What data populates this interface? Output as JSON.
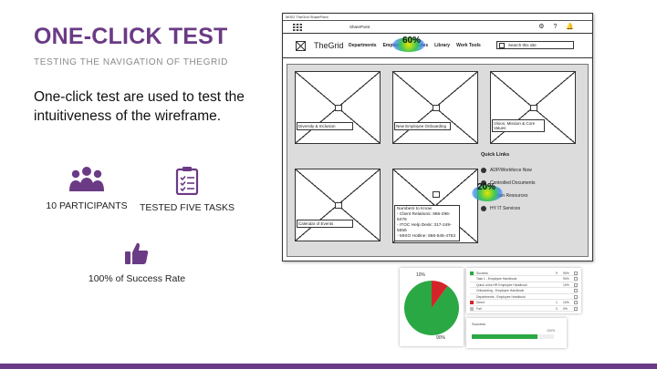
{
  "slide": {
    "title": "ONE-CLICK TEST",
    "subtitle": "TESTING THE NAVIGATION OF THEGRID",
    "intro": "One-click test are used to test the intuitiveness of the wireframe.",
    "accent_color": "#6b3a85"
  },
  "stats": [
    {
      "icon": "people-icon",
      "label": "10 PARTICIPANTS"
    },
    {
      "icon": "clipboard-checklist-icon",
      "label": "TESTED FIVE TASKS"
    },
    {
      "icon": "thumbs-up-icon",
      "label": "100% of Success Rate"
    }
  ],
  "wireframe": {
    "tab_title": "MISO TheGrid SharePoint",
    "app_name": "SharePoint",
    "top_icons": "⚙ ? 🔔",
    "logo": "TheGrid",
    "nav_items": [
      "Departments",
      "Employee",
      "Policies",
      "Library",
      "Work Tools"
    ],
    "search_placeholder": "Search this site",
    "heatmap_top_label": "60%",
    "heatmap_links_label": "20%",
    "tiles": [
      {
        "label": "Diversity & Inclusion"
      },
      {
        "label": "New Employee Onboarding"
      },
      {
        "label": "Vision, Mission & Core Values"
      },
      {
        "label": "Calendar of Events"
      }
    ],
    "numbers": {
      "title": "Numbers to Know",
      "lines": [
        "- Client Relations: 866-296-6476",
        "- ITOC Help Desk: 317-249-5555",
        "- MISO Hotline: 866-546-4753"
      ]
    },
    "quick_links": {
      "title": "Quick Links",
      "items": [
        "ADP/Workforce Now",
        "Controlled Documents",
        "Human Resources",
        "HY IT Services"
      ]
    }
  },
  "results": {
    "pie": {
      "success_pct": "90%",
      "fail_pct": "10%",
      "success": 90,
      "fail": 10,
      "success_color": "#2aa844",
      "fail_color": "#d4242a"
    },
    "table_rows": [
      {
        "label": "Success",
        "count": "9",
        "pct": "90%",
        "color": "#2aa844"
      },
      {
        "label": "Task 1 - Employee Handbook",
        "count": "",
        "pct": "90%",
        "color": "#ffffff"
      },
      {
        "label": "Quick Links HR Employee Handbook",
        "count": "",
        "pct": "10%",
        "color": "#ffffff"
      },
      {
        "label": "Onboarding - Employee Handbook",
        "count": "",
        "pct": "",
        "color": "#ffffff"
      },
      {
        "label": "Departments - Employee Handbook",
        "count": "",
        "pct": "",
        "color": "#ffffff"
      },
      {
        "label": "Direct",
        "count": "1",
        "pct": "10%",
        "color": "#d4242a"
      },
      {
        "label": "Fail",
        "count": "0",
        "pct": "0%",
        "color": "#bbbbbb"
      }
    ],
    "bar": {
      "title": "Success",
      "value_label": "100%",
      "fraction": 0.8
    }
  }
}
